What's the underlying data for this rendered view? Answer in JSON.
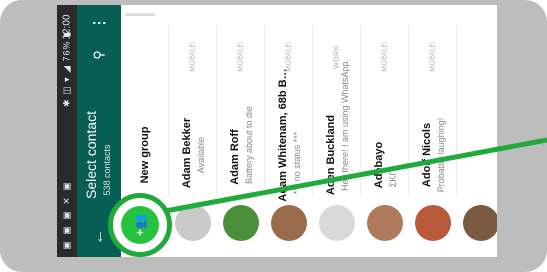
{
  "status_bar": {
    "time": "12:00",
    "icons": "✱ ◫ ▾ ◢ 76% ▮",
    "notifications": "▣ ▣ ▣ ✕ ▣"
  },
  "toolbar": {
    "title": "Select contact",
    "subtitle": "538 contacts",
    "back_icon": "←",
    "search_icon": "⚲",
    "more_icon": "⋮"
  },
  "new_group": {
    "label": "New group",
    "icon": "+👥"
  },
  "contacts": [
    {
      "name": "Adam Bekker",
      "status": "Available",
      "tag": "MOBILE",
      "avatar_color": "#c9c9c9"
    },
    {
      "name": "Adam Roff",
      "status": "Battery about to die",
      "tag": "MOBILE",
      "avatar_color": "#4c8f3a"
    },
    {
      "name": "Adam Whitenam, 68b B…",
      "status": "*** no status ***",
      "tag": "MOBILE",
      "avatar_color": "#9a6b4a"
    },
    {
      "name": "Aden Buckland",
      "status": "Hey there! I am using WhatsApp.",
      "tag": "WORK",
      "avatar_color": "#d9d9d9"
    },
    {
      "name": "Adebayo",
      "status": "ΣΚΓ",
      "tag": "MOBILE",
      "avatar_color": "#b07a5c"
    },
    {
      "name": "Adolf Nicols",
      "status": "Probably laughing!",
      "tag": "MOBILE",
      "avatar_color": "#b85a3a"
    },
    {
      "name": "",
      "status": "",
      "tag": "",
      "avatar_color": "#7a5a40"
    }
  ],
  "colors": {
    "toolbar": "#075e54",
    "accent_green": "#25c23f",
    "pointer_green": "#1faa3a"
  }
}
